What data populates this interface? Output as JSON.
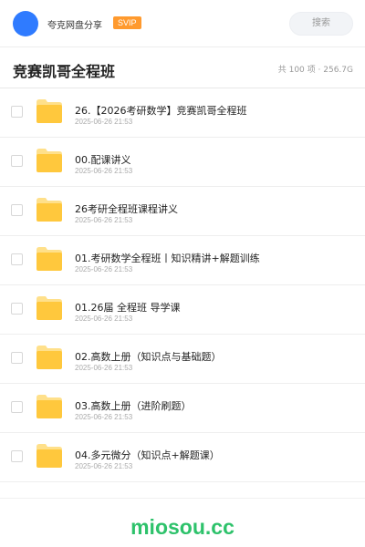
{
  "header": {
    "username": "夸克网盘分享",
    "vip_badge": "SVIP",
    "search_placeholder": "搜索"
  },
  "folder": {
    "title": "竞赛凯哥全程班",
    "summary_count": "共 100 项",
    "summary_size": "256.7G"
  },
  "items": [
    {
      "name": "26.【2026考研数学】竞赛凯哥全程班",
      "date": "2025-06-26 21:53"
    },
    {
      "name": "00.配课讲义",
      "date": "2025-06-26 21:53"
    },
    {
      "name": "26考研全程班课程讲义",
      "date": "2025-06-26 21:53"
    },
    {
      "name": "01.考研数学全程班丨知识精讲+解题训练",
      "date": "2025-06-26 21:53"
    },
    {
      "name": "01.26届 全程班 导学课",
      "date": "2025-06-26 21:53"
    },
    {
      "name": "02.高数上册（知识点与基础题）",
      "date": "2025-06-26 21:53"
    },
    {
      "name": "03.高数上册（进阶刷题）",
      "date": "2025-06-26 21:53"
    },
    {
      "name": "04.多元微分（知识点+解题课）",
      "date": "2025-06-26 21:53"
    }
  ],
  "footer": {
    "watermark": "miosou.cc"
  },
  "colors": {
    "avatar": "#2f7bff",
    "vip_badge": "#ff9a2e",
    "folder_body": "#ffc83d",
    "folder_tab": "#ffe08a",
    "watermark": "#2ec26b"
  }
}
